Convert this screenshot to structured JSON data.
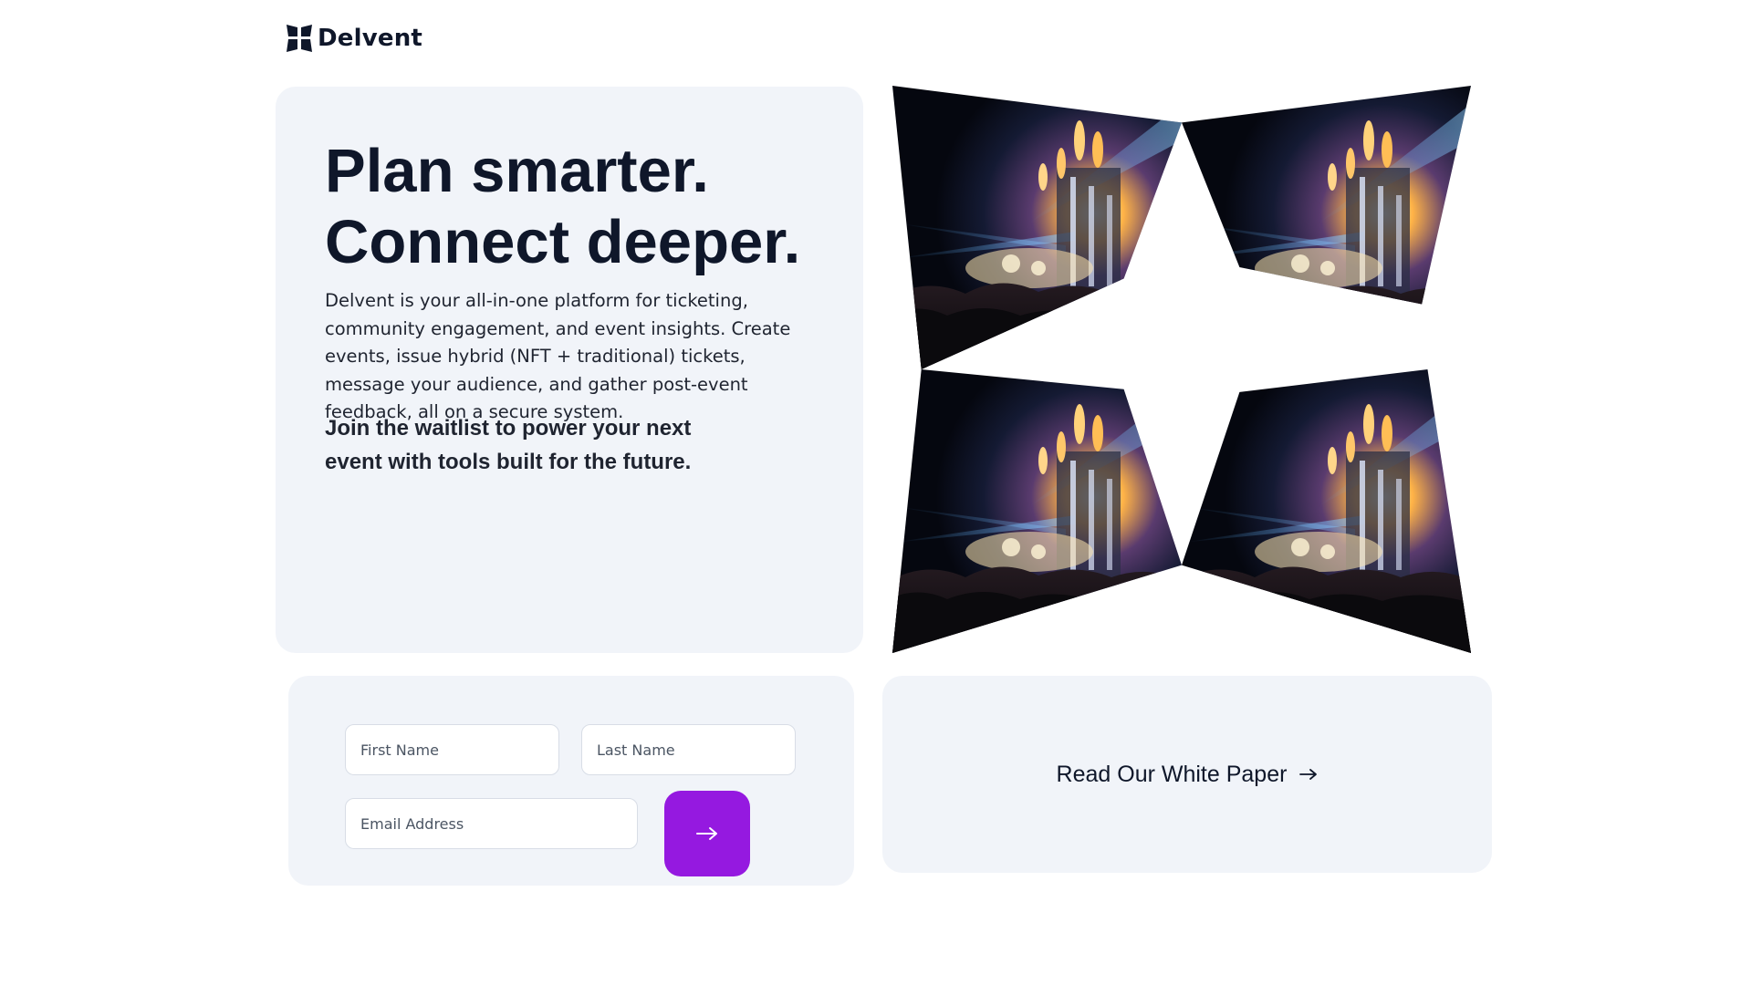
{
  "brand": {
    "name": "Delvent",
    "logo_icon": "delvent-logo-icon"
  },
  "hero": {
    "title_line1": "Plan smarter.",
    "title_line2": "Connect deeper.",
    "description": "Delvent is your all-in-one platform for ticketing, community engagement, and event insights. Create events, issue hybrid (NFT + traditional) tickets, message your audience, and gather post-event feedback, all on a secure system.",
    "cta": "Join the waitlist to power your next event with tools built for the future."
  },
  "collage": {
    "image_subject": "concert-crowd-stage-photo",
    "tile_count": 4
  },
  "waitlist_form": {
    "first_name_placeholder": "First Name",
    "last_name_placeholder": "Last Name",
    "email_placeholder": "Email Address",
    "submit_icon": "arrow-right-icon"
  },
  "white_paper": {
    "label": "Read Our White Paper",
    "icon": "arrow-right-icon"
  },
  "colors": {
    "accent": "#9519e0",
    "card_bg": "#f1f4f9",
    "text_primary": "#0f172a"
  }
}
